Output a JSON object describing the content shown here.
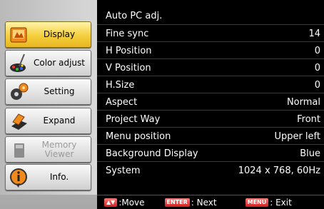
{
  "sidebar": {
    "items": [
      {
        "label": "Display",
        "icon": "display-icon",
        "state": "selected"
      },
      {
        "label": "Color adjust",
        "icon": "color-adjust-icon",
        "state": "normal"
      },
      {
        "label": "Setting",
        "icon": "gears-icon",
        "state": "normal"
      },
      {
        "label": "Expand",
        "icon": "expand-icon",
        "state": "normal"
      },
      {
        "label": "Memory\nViewer",
        "icon": "memory-viewer-icon",
        "state": "disabled"
      },
      {
        "label": "Info.",
        "icon": "info-icon",
        "state": "normal"
      }
    ]
  },
  "rows": [
    {
      "label": "Auto PC adj.",
      "value": ""
    },
    {
      "label": "Fine sync",
      "value": "14"
    },
    {
      "label": "H Position",
      "value": "0"
    },
    {
      "label": "V Position",
      "value": "0"
    },
    {
      "label": "H.Size",
      "value": "0"
    },
    {
      "label": "Aspect",
      "value": "Normal"
    },
    {
      "label": "Project Way",
      "value": "Front"
    },
    {
      "label": "Menu position",
      "value": "Upper left"
    },
    {
      "label": "Background Display",
      "value": "Blue"
    },
    {
      "label": "System",
      "value": "1024 x 768, 60Hz"
    }
  ],
  "help": {
    "move_key": "▲▼",
    "move_label": ":Move",
    "enter_key": "ENTER",
    "enter_label": ": Next",
    "menu_key": "MENU",
    "menu_label": ": Exit"
  },
  "colors": {
    "selected_bg": "#f4cf3d",
    "key_red": "#d21d1d",
    "panel_bg": "#000000"
  }
}
